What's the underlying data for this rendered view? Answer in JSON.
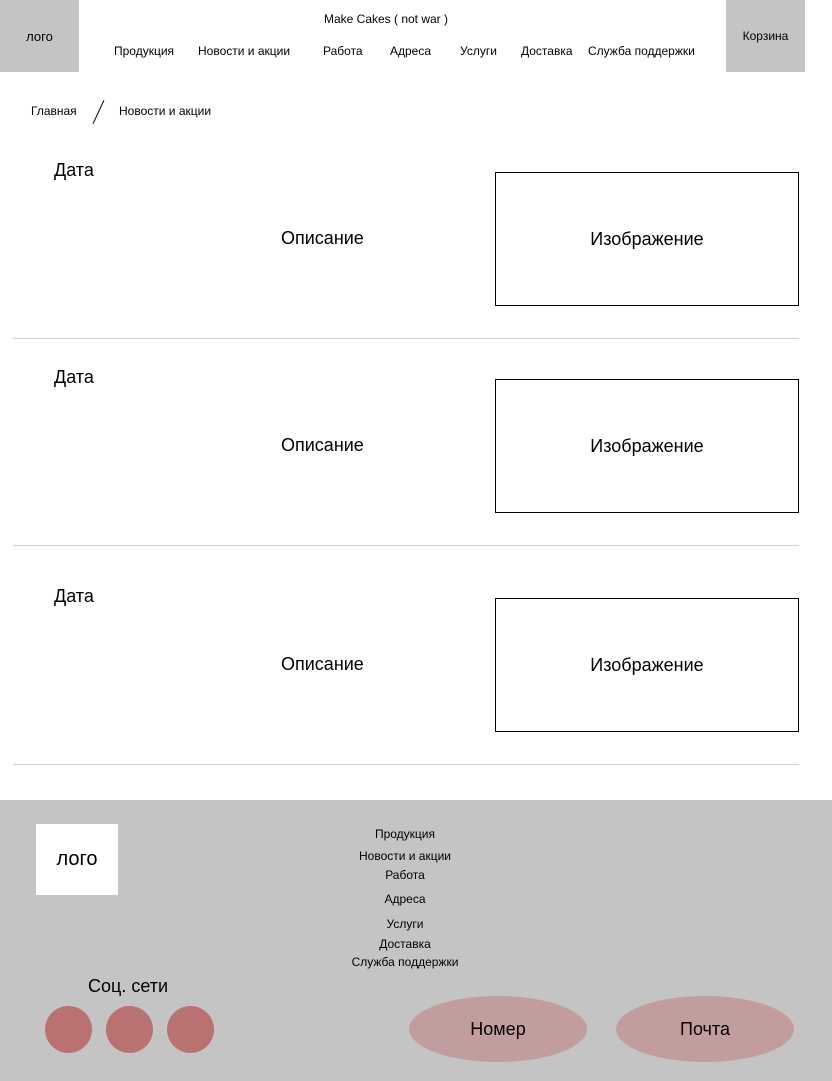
{
  "header": {
    "logo": "лого",
    "site_title": "Make Cakes ( not war )",
    "cart": "Корзина",
    "nav": [
      "Продукция",
      "Новости и акции",
      "Работа",
      "Адреса",
      "Услуги",
      "Доставка",
      "Служба поддержки"
    ]
  },
  "breadcrumb": {
    "home": "Главная",
    "current": "Новости и акции"
  },
  "news": [
    {
      "date": "Дата",
      "description": "Описание",
      "image": "Изображение"
    },
    {
      "date": "Дата",
      "description": "Описание",
      "image": "Изображение"
    },
    {
      "date": "Дата",
      "description": "Описание",
      "image": "Изображение"
    }
  ],
  "footer": {
    "logo": "лого",
    "links": [
      "Продукция",
      "Новости и акции",
      "Работа",
      "Адреса",
      "Услуги",
      "Доставка",
      "Служба поддержки"
    ],
    "social_title": "Соц. сети",
    "phone": "Номер",
    "mail": "Почта"
  },
  "colors": {
    "panel": "#c4c4c4",
    "social": "#b97171",
    "pill": "#c29d9d"
  }
}
